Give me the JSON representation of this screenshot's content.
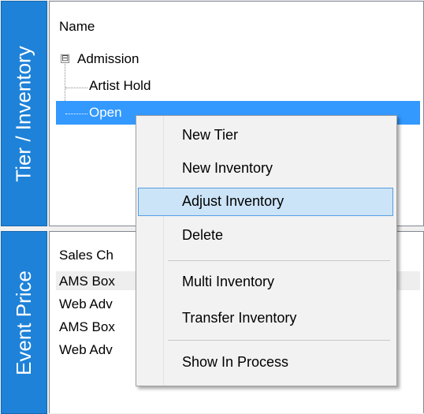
{
  "tabs": {
    "top_label": "Tier / Inventory",
    "bottom_label": "Event Price"
  },
  "tier_panel": {
    "column_header": "Name",
    "tree": {
      "root": {
        "label": "Admission",
        "expander": "⊟"
      },
      "children": [
        {
          "label": "Artist Hold"
        },
        {
          "label": "Open"
        }
      ]
    }
  },
  "price_panel": {
    "column_header": "Sales Ch",
    "rows": [
      "AMS Box",
      "Web Adv",
      "AMS Box",
      "Web Adv"
    ]
  },
  "context_menu": {
    "items": [
      {
        "label": "New Tier"
      },
      {
        "label": "New Inventory"
      },
      {
        "label": "Adjust Inventory",
        "highlighted": true
      },
      {
        "label": "Delete"
      },
      {
        "label": "Multi Inventory"
      },
      {
        "label": "Transfer Inventory"
      },
      {
        "label": "Show In Process"
      }
    ]
  },
  "colors": {
    "tab_blue": "#1e82d8",
    "selection": "#3399ff",
    "menu_highlight": "#cce4f7"
  }
}
